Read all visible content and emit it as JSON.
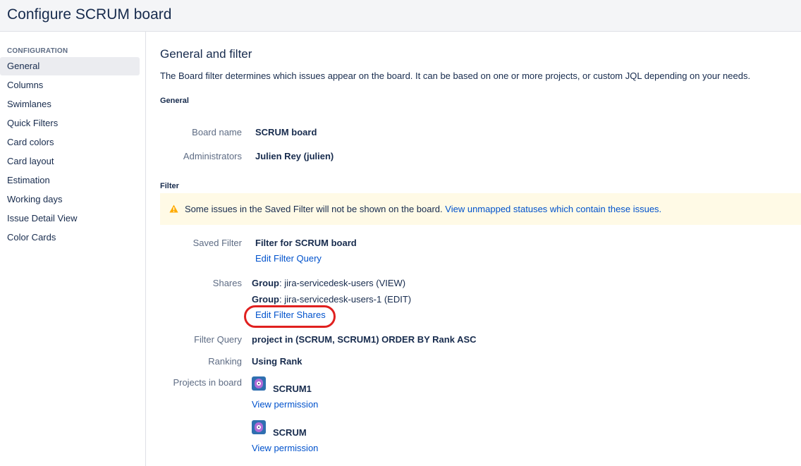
{
  "header": {
    "title": "Configure SCRUM board"
  },
  "sidebar": {
    "heading": "CONFIGURATION",
    "items": [
      {
        "label": "General",
        "active": true
      },
      {
        "label": "Columns"
      },
      {
        "label": "Swimlanes"
      },
      {
        "label": "Quick Filters"
      },
      {
        "label": "Card colors"
      },
      {
        "label": "Card layout"
      },
      {
        "label": "Estimation"
      },
      {
        "label": "Working days"
      },
      {
        "label": "Issue Detail View"
      },
      {
        "label": "Color Cards"
      }
    ]
  },
  "main": {
    "title": "General and filter",
    "intro": "The Board filter determines which issues appear on the board. It can be based on one or more projects, or custom JQL depending on your needs.",
    "general": {
      "heading": "General",
      "board_name_label": "Board name",
      "board_name": "SCRUM board",
      "administrators_label": "Administrators",
      "administrators": "Julien Rey (julien)"
    },
    "filter": {
      "heading": "Filter",
      "warning_text": "Some issues in the Saved Filter will not be shown on the board.",
      "warning_link": "View unmapped statuses which contain these issues.",
      "saved_filter_label": "Saved Filter",
      "saved_filter": "Filter for SCRUM board",
      "edit_filter_query": "Edit Filter Query",
      "shares_label": "Shares",
      "shares": [
        {
          "type": "Group",
          "value": ": jira-servicedesk-users (VIEW)"
        },
        {
          "type": "Group",
          "value": ": jira-servicedesk-users-1 (EDIT)"
        }
      ],
      "edit_filter_shares": "Edit Filter Shares",
      "filter_query_label": "Filter Query",
      "filter_query": "project in (SCRUM, SCRUM1) ORDER BY Rank ASC",
      "ranking_label": "Ranking",
      "ranking": "Using Rank",
      "projects_label": "Projects in board",
      "projects": [
        {
          "name": "SCRUM1",
          "link": "View permission"
        },
        {
          "name": "SCRUM",
          "link": "View permission"
        }
      ]
    }
  },
  "colors": {
    "link": "#0052cc",
    "warning_bg": "#fffae6",
    "warning_icon": "#ffab00",
    "highlight": "#e0201f",
    "active_item_bg": "#ebecf0"
  },
  "icons": {
    "warning": "warning-triangle-icon",
    "project_avatar": "project-avatar-icon"
  }
}
